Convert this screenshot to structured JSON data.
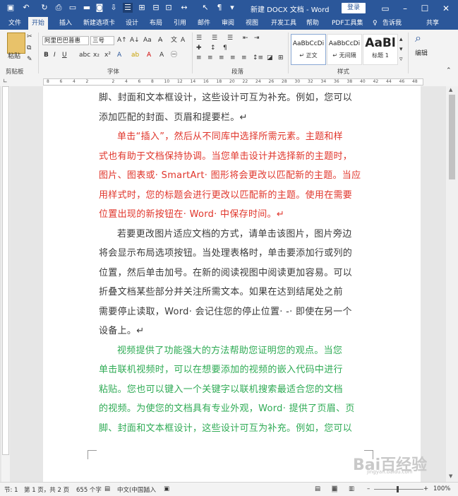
{
  "title_bar": {
    "document_title": "新建 DOCX 文档 - Word",
    "login_label": "登录",
    "window_buttons": [
      "ribbon-display-icon",
      "minimize-icon",
      "maximize-icon",
      "close-icon"
    ]
  },
  "tabs": [
    "文件",
    "开始",
    "插入",
    "新建选项卡",
    "设计",
    "布局",
    "引用",
    "邮件",
    "审阅",
    "视图",
    "开发工具",
    "帮助",
    "PDF工具集",
    "告诉我",
    "共享"
  ],
  "ribbon": {
    "paste_label": "粘贴",
    "font_name": "阿里巴巴普惠",
    "font_size": "三号",
    "group_labels": {
      "clipboard": "剪贴板",
      "font": "字体",
      "paragraph": "段落",
      "styles": "样式",
      "editing": "编辑"
    },
    "styles": [
      {
        "sample": "AaBbCcDi",
        "name": "↵ 正文"
      },
      {
        "sample": "AaBbCcDi",
        "name": "↵ 无间隔"
      },
      {
        "sample": "AaBl",
        "name": "标题 1"
      }
    ],
    "editing_label": "编辑"
  },
  "ruler": {
    "ticks": [
      "8",
      "6",
      "4",
      "2",
      "",
      "2",
      "4",
      "6",
      "8",
      "10",
      "12",
      "14",
      "16",
      "18",
      "20",
      "22",
      "24",
      "26",
      "28",
      "30",
      "32",
      "34",
      "36",
      "38",
      "40",
      "42",
      "44",
      "46",
      "48"
    ]
  },
  "document": {
    "paragraphs": [
      {
        "color": "dark",
        "lines": [
          "脚、封面和文本框设计，这些设计可互为补充。例如，您可以",
          "添加匹配的封面、页眉和提要栏。↵"
        ]
      },
      {
        "color": "red",
        "lines": [
          "单击“插入”，然后从不同库中选择所需元素。主题和样",
          "式也有助于文档保持协调。当您单击设计并选择新的主题时，",
          "图片、图表或· SmartArt· 图形将会更改以匹配新的主题。当应",
          "用样式时，您的标题会进行更改以匹配新的主题。使用在需要",
          "位置出现的新按钮在· Word· 中保存时间。↵"
        ]
      },
      {
        "color": "dark",
        "lines": [
          "若要更改图片适应文档的方式，请单击该图片，图片旁边",
          "将会显示布局选项按钮。当处理表格时，单击要添加行或列的",
          "位置，然后单击加号。在新的阅读视图中阅读更加容易。可以",
          "折叠文档某些部分并关注所需文本。如果在达到结尾处之前",
          "需要停止读取，Word· 会记住您的停止位置· -· 即使在另一个",
          "设备上。↵"
        ]
      },
      {
        "color": "green",
        "lines": [
          "视频提供了功能强大的方法帮助您证明您的观点。当您",
          "单击联机视频时，可以在想要添加的视频的嵌入代码中进行",
          "粘贴。您也可以键入一个关键字以联机搜索最适合您的文档",
          "的视频。为使您的文档具有专业外观，Word· 提供了页眉、页",
          "脚、封面和文本框设计，这些设计可互为补充。例如，您可以"
        ]
      }
    ]
  },
  "status_bar": {
    "section": "节: 1",
    "page": "第 1 页，共 2 页",
    "words": "655 个字",
    "language": "中文(中国)",
    "insert_mode": "插入",
    "zoom": "100%"
  },
  "watermark": {
    "text": "Bai百经验",
    "sub": "jingyan.baidu.com"
  }
}
